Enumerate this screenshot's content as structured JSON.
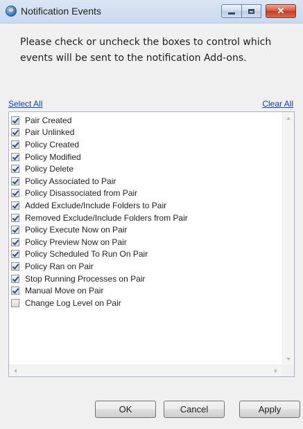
{
  "window": {
    "title": "Notification Events",
    "close_glyph": "✕"
  },
  "instructions": "Please check or uncheck the boxes to control which events will be sent to the notification Add-ons.",
  "links": {
    "select_all": "Select All",
    "clear_all": "Clear All"
  },
  "events": [
    {
      "label": "Pair Created",
      "checked": true
    },
    {
      "label": "Pair Unlinked",
      "checked": true
    },
    {
      "label": "Policy Created",
      "checked": true
    },
    {
      "label": "Policy Modified",
      "checked": true
    },
    {
      "label": "Policy Delete",
      "checked": true
    },
    {
      "label": "Policy Associated to Pair",
      "checked": true
    },
    {
      "label": "Policy Disassociated from Pair",
      "checked": true
    },
    {
      "label": "Added Exclude/Include Folders to Pair",
      "checked": true
    },
    {
      "label": "Removed Exclude/Include Folders from Pair",
      "checked": true
    },
    {
      "label": "Policy Execute Now on Pair",
      "checked": true
    },
    {
      "label": "Policy Preview Now on Pair",
      "checked": true
    },
    {
      "label": "Policy Scheduled To Run On Pair",
      "checked": true
    },
    {
      "label": "Policy Ran on Pair",
      "checked": true
    },
    {
      "label": "Stop Running Processes on Pair",
      "checked": true
    },
    {
      "label": "Manual Move on Pair",
      "checked": true
    },
    {
      "label": "Change Log Level on Pair",
      "checked": false
    }
  ],
  "buttons": {
    "ok": "OK",
    "cancel": "Cancel",
    "apply": "Apply"
  },
  "icons": {
    "app": "notification-app-icon",
    "minimize": "minimize-icon",
    "maximize": "maximize-icon",
    "close": "close-icon"
  },
  "colors": {
    "link": "#0b3fb3",
    "close_button": "#d5533b",
    "check": "#2a4f8f"
  }
}
